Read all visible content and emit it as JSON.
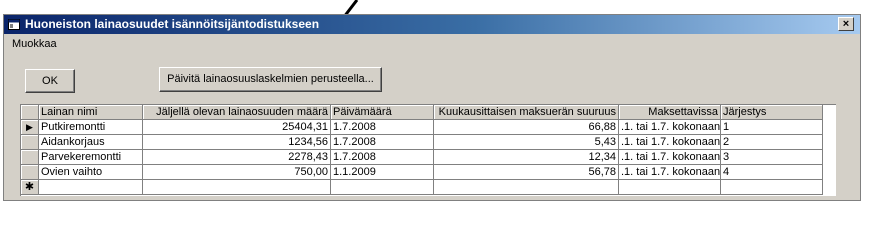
{
  "window": {
    "title": "Huoneiston lainaosuudet isännöitsijäntodistukseen",
    "close_glyph": "×"
  },
  "menu": {
    "items": [
      "Muokkaa"
    ]
  },
  "buttons": {
    "ok_label": "OK",
    "update_label": "Päivitä lainaosuuslaskelmien perusteella..."
  },
  "grid": {
    "columns": [
      "Lainan nimi",
      "Jäljellä olevan lainaosuuden määrä",
      "Päivämäärä",
      "Kuukausittaisen maksuerän suuruus",
      "Maksettavissa",
      "Järjestys"
    ],
    "rows": [
      [
        "Putkiremontti",
        "25404,31",
        "1.7.2008",
        "66,88",
        ".1. tai 1.7. kokonaan",
        "1"
      ],
      [
        "Aidankorjaus",
        "1234,56",
        "1.7.2008",
        "5,43",
        ".1. tai 1.7. kokonaan",
        "2"
      ],
      [
        "Parvekeremontti",
        "2278,43",
        "1.7.2008",
        "12,34",
        ".1. tai 1.7. kokonaan",
        "3"
      ],
      [
        "Ovien vaihto",
        "750,00",
        "1.1.2009",
        "56,78",
        ".1. tai 1.7. kokonaan",
        "4"
      ]
    ],
    "current_row_glyph": "▶",
    "new_row_glyph": "✱"
  },
  "colors": {
    "titlebar_start": "#0a246a",
    "titlebar_end": "#a6caf0",
    "face": "#d4d0c8"
  }
}
